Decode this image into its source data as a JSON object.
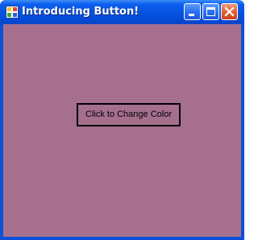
{
  "window": {
    "title": "Introducing Button!",
    "controls": {
      "minimize": "minimize-icon",
      "maximize": "maximize-icon",
      "close": "close-icon"
    }
  },
  "client": {
    "background_color": "#a66f8e",
    "button": {
      "label": "Click to Change Color"
    }
  },
  "colors": {
    "titlebar": "#0654e0",
    "close_button": "#e35d30",
    "client_background": "#a66f8e"
  }
}
